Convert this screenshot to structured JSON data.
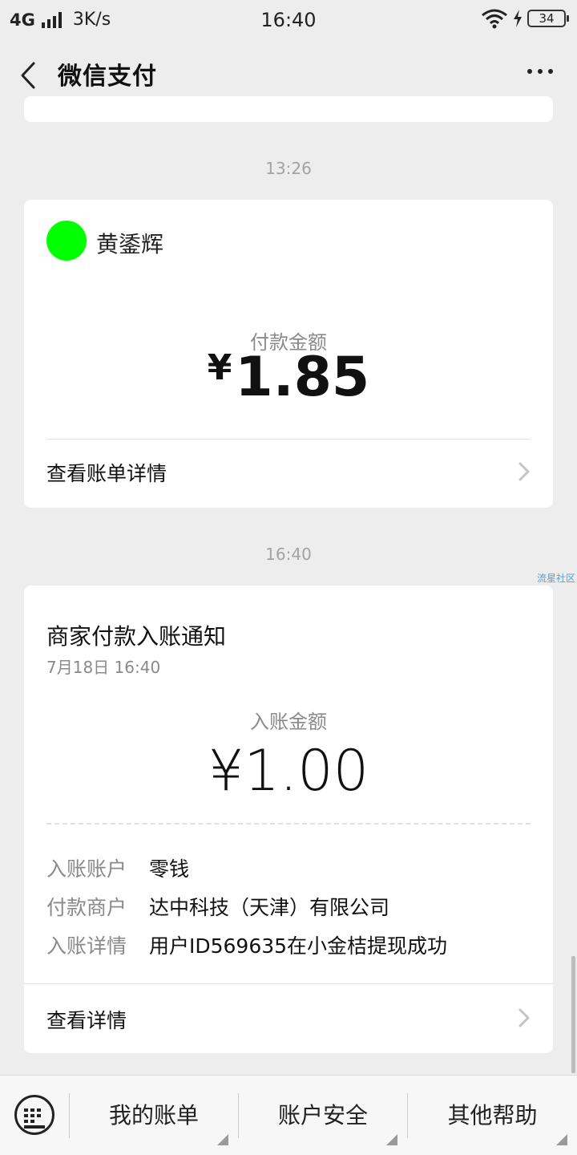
{
  "status_bar": {
    "network": "4G",
    "speed": "3K/s",
    "time": "16:40",
    "battery": "34"
  },
  "nav": {
    "title": "微信支付"
  },
  "messages": [
    {
      "timestamp": "13:26",
      "payer_name": "黄鋈辉",
      "avatar_color": "#00ff00",
      "amount_label": "付款金额",
      "amount_symbol": "¥",
      "amount_value": "1.85",
      "link_label": "查看账单详情"
    },
    {
      "timestamp": "16:40",
      "title": "商家付款入账通知",
      "date": "7月18日  16:40",
      "amount_label": "入账金额",
      "amount": "¥1.00",
      "details": [
        {
          "key": "入账账户",
          "value": "零钱"
        },
        {
          "key": "付款商户",
          "value": "达中科技（天津）有限公司"
        },
        {
          "key": "入账详情",
          "value": "用户ID569635在小金桔提现成功"
        }
      ],
      "link_label": "查看详情"
    }
  ],
  "watermark": "流星社区",
  "bottom_menu": {
    "items": [
      "我的账单",
      "账户安全",
      "其他帮助"
    ]
  }
}
